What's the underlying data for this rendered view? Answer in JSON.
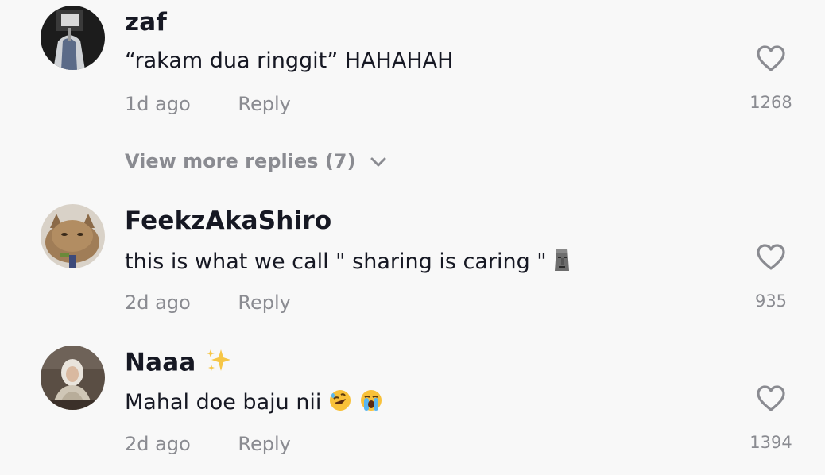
{
  "comments": [
    {
      "username": "zaf",
      "text": "“rakam dua ringgit” HAHAHAH",
      "time": "1d ago",
      "reply_label": "Reply",
      "likes": "1268"
    },
    {
      "username": "FeekzAkaShiro",
      "text": "this is what we call \" sharing is caring \"",
      "emoji": "moai-icon",
      "time": "2d ago",
      "reply_label": "Reply",
      "likes": "935"
    },
    {
      "username": "Naaa",
      "username_emoji": "sparkles-icon",
      "text": "Mahal doe baju nii",
      "emoji": [
        "rofl-icon",
        "loudly-crying-face-icon"
      ],
      "time": "2d ago",
      "reply_label": "Reply",
      "likes": "1394"
    }
  ],
  "view_more": {
    "label": "View more replies (7)"
  },
  "colors": {
    "background": "#f8f8f8",
    "text": "#161823",
    "secondary": "#8a8b91"
  }
}
